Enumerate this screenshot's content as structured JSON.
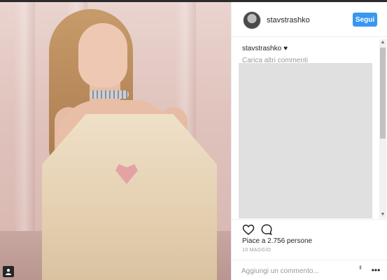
{
  "post": {
    "username": "stavstrashko",
    "follow_label": "Segui",
    "caption_user": "stavstrashko",
    "caption_heart": "♥",
    "load_more_comments": "Carica altri commenti",
    "likes_text": "Piace a 2.756 persone",
    "date_text": "10 MAGGIO",
    "comment_placeholder": "Aggiungi un commento...",
    "more_options": "•••"
  },
  "icons": {
    "like": "heart-outline-icon",
    "comment": "speech-bubble-icon",
    "tagged_user": "user-tag-icon",
    "avatar": "profile-picture",
    "scroll_up": "▲",
    "scroll_down": "▼",
    "spinner": "⬍"
  },
  "colors": {
    "accent": "#3897f0",
    "text": "#262626",
    "muted": "#999999",
    "border": "#efefef",
    "placeholder_block": "#e0e0e0"
  }
}
